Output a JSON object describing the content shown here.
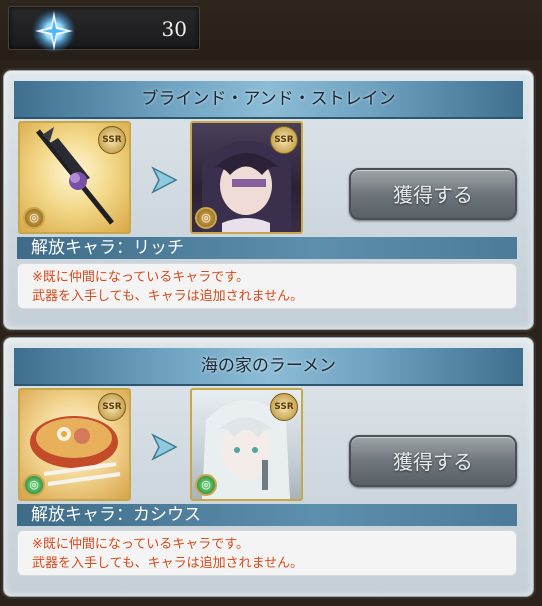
{
  "currency": {
    "icon": "crystal-icon",
    "value": "30"
  },
  "cards": [
    {
      "title": "ブラインド・アンド・ストレイン",
      "weapon_icon": "scythe-weapon-icon",
      "weapon_rarity": "SSR",
      "weapon_element": "dark",
      "character_rarity": "SSR",
      "button_label": "獲得する",
      "unlock_label": "解放キャラ：リッチ",
      "note_line1": "※既に仲間になっているキャラです。",
      "note_line2": "武器を入手しても、キャラは追加されません。"
    },
    {
      "title": "海の家のラーメン",
      "weapon_icon": "ramen-weapon-icon",
      "weapon_rarity": "SSR",
      "weapon_element": "wind",
      "character_rarity": "SSR",
      "button_label": "獲得する",
      "unlock_label": "解放キャラ：カシウス",
      "note_line1": "※既に仲間になっているキャラです。",
      "note_line2": "武器を入手しても、キャラは追加されません。"
    }
  ],
  "colors": {
    "note_text": "#d84b1c",
    "title_bar": "#6fa3c1",
    "background": "#2b231b"
  }
}
